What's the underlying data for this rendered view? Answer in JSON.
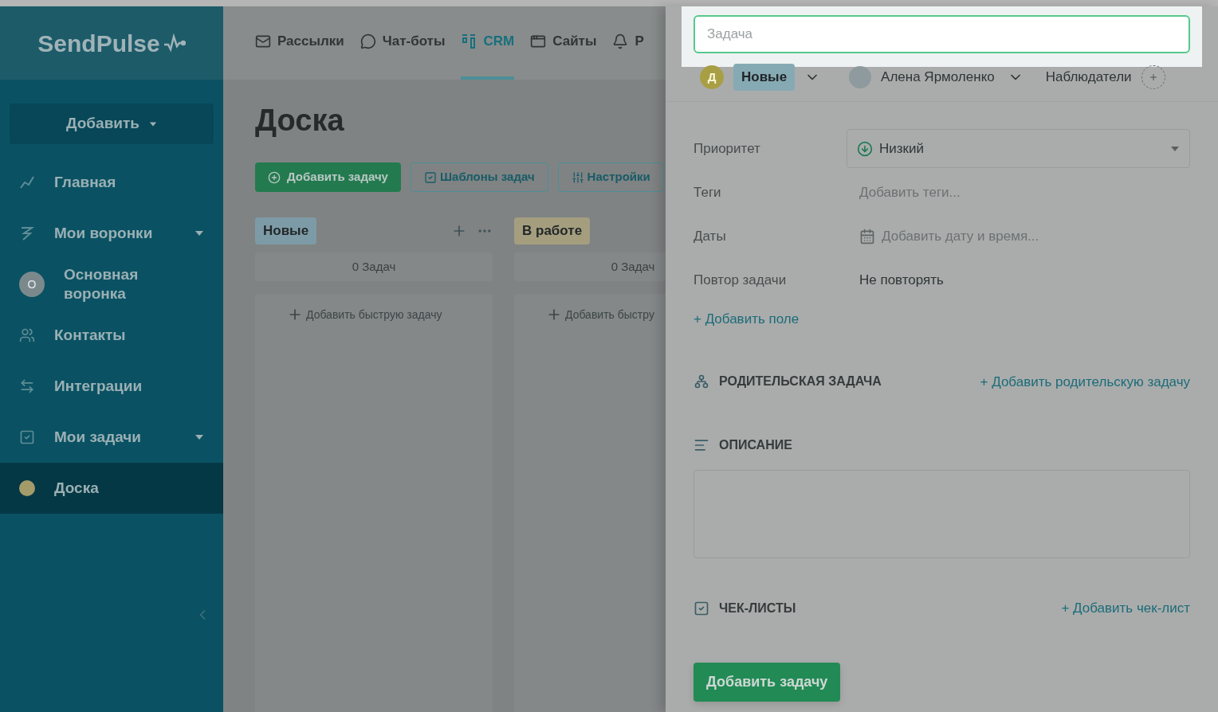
{
  "logo": {
    "text": "SendPulse"
  },
  "sidebar": {
    "add_button": "Добавить",
    "items": [
      {
        "label": "Главная",
        "kind": "icon",
        "expandable": false,
        "selected": false
      },
      {
        "label": "Мои воронки",
        "kind": "icon",
        "expandable": true,
        "selected": false
      },
      {
        "label": "Основная воронка",
        "kind": "avatar",
        "avatar": "О",
        "expandable": false,
        "selected": false
      },
      {
        "label": "Контакты",
        "kind": "icon",
        "expandable": false,
        "selected": false
      },
      {
        "label": "Интеграции",
        "kind": "icon",
        "expandable": false,
        "selected": false
      },
      {
        "label": "Мои задачи",
        "kind": "icon",
        "expandable": true,
        "selected": false
      },
      {
        "label": "Доска",
        "kind": "dot",
        "color": "#a39c6a",
        "expandable": false,
        "selected": true
      }
    ]
  },
  "top_nav": [
    {
      "label": "Рассылки",
      "selected": false
    },
    {
      "label": "Чат-боты",
      "selected": false
    },
    {
      "label": "CRM",
      "selected": true
    },
    {
      "label": "Сайты",
      "selected": false
    },
    {
      "label": "Р",
      "selected": false
    }
  ],
  "board": {
    "title": "Доска",
    "buttons": [
      {
        "label": "Добавить задачу",
        "kind": "primary"
      },
      {
        "label": "Шаблоны задач",
        "kind": "outline"
      },
      {
        "label": "Настройки",
        "kind": "outline"
      }
    ],
    "columns": [
      {
        "name": "Новые",
        "color": "#7d9ba6",
        "count": "0 Задач",
        "quick_add": "Добавить быструю задачу"
      },
      {
        "name": "В работе",
        "color": "#a49e7f",
        "count": "0 Задач",
        "quick_add": "Добавить быстру"
      }
    ]
  },
  "task_panel": {
    "title_field": {
      "placeholder": "Задача"
    },
    "status": {
      "avatar": "Д",
      "label": "Новые"
    },
    "assignee": "Алена Ярмоленко",
    "watchers": "Наблюдатели",
    "fields": [
      {
        "label": "Приоритет",
        "kind": "select",
        "value": "Низкий"
      },
      {
        "label": "Теги",
        "kind": "tags",
        "placeholder": "Добавить теги..."
      },
      {
        "label": "Даты",
        "kind": "date",
        "placeholder": "Добавить дату и время..."
      },
      {
        "label": "Повтор задачи",
        "kind": "text",
        "value": "Не повторять"
      }
    ],
    "add_field": "+ Добавить поле",
    "parent_task": {
      "title": "РОДИТЕЛЬСКАЯ ЗАДАЧА",
      "link": "+ Добавить родительскую задачу"
    },
    "description": {
      "title": "ОПИСАНИЕ"
    },
    "checklists": {
      "title": "ЧЕК-ЛИСТЫ",
      "link": "+ Добавить чек-лист"
    },
    "submit": "Добавить задачу"
  }
}
